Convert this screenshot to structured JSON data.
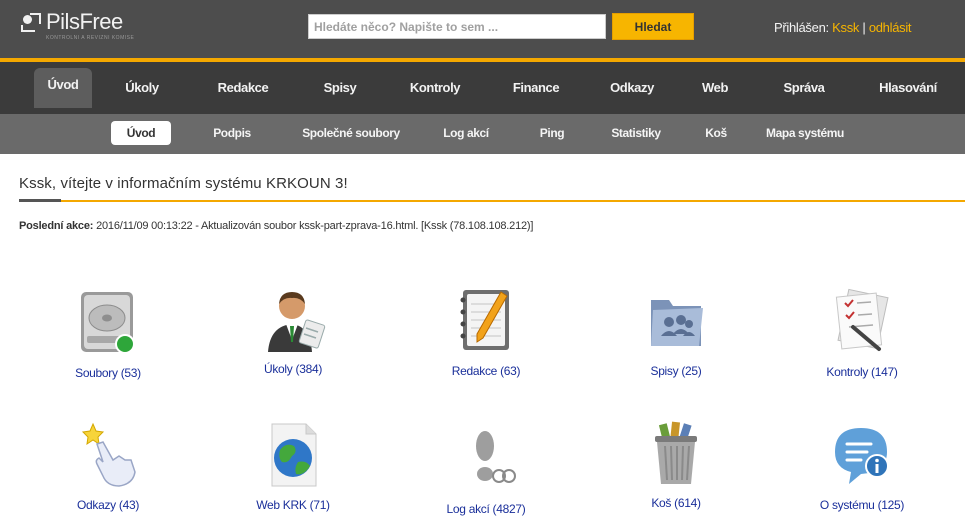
{
  "header": {
    "logo_text": "PilsFree",
    "logo_subtitle": "KONTROLNI A REVIZNI KOMISE",
    "search_placeholder": "Hledáte něco? Napište to sem ...",
    "search_button": "Hledat",
    "login_prefix": "Přihlášen: ",
    "login_user": "Kssk",
    "login_separator": " | ",
    "logout_label": "odhlásit"
  },
  "main_nav": {
    "items": [
      {
        "label": "Úvod",
        "active": true
      },
      {
        "label": "Úkoly"
      },
      {
        "label": "Redakce"
      },
      {
        "label": "Spisy"
      },
      {
        "label": "Kontroly"
      },
      {
        "label": "Finance"
      },
      {
        "label": "Odkazy"
      },
      {
        "label": "Web"
      },
      {
        "label": "Správa"
      },
      {
        "label": "Hlasování"
      }
    ]
  },
  "sub_nav": {
    "items": [
      {
        "label": "Úvod",
        "active": true
      },
      {
        "label": "Podpis"
      },
      {
        "label": "Společné soubory"
      },
      {
        "label": "Log akcí"
      },
      {
        "label": "Ping"
      },
      {
        "label": "Statistiky"
      },
      {
        "label": "Koš"
      },
      {
        "label": "Mapa systému"
      }
    ]
  },
  "content": {
    "welcome": "Kssk, vítejte v informačním systému KRKOUN 3!",
    "last_action_label": "Poslední akce:",
    "last_action_text": " 2016/11/09 00:13:22 - Aktualizován soubor kssk-part-zprava-16.html. [Kssk (78.108.108.212)]"
  },
  "tiles": [
    {
      "label": "Soubory (53)",
      "icon": "hard-drive-icon"
    },
    {
      "label": "Úkoly (384)",
      "icon": "businessman-icon"
    },
    {
      "label": "Redakce (63)",
      "icon": "notepad-pencil-icon"
    },
    {
      "label": "Spisy (25)",
      "icon": "folder-users-icon"
    },
    {
      "label": "Kontroly (147)",
      "icon": "checklist-icon"
    },
    {
      "label": "Odkazy (43)",
      "icon": "pointing-hand-icon"
    },
    {
      "label": "Web KRK (71)",
      "icon": "globe-page-icon"
    },
    {
      "label": "Log akcí (4827)",
      "icon": "footprint-icon"
    },
    {
      "label": "Koš (614)",
      "icon": "trash-bin-icon"
    },
    {
      "label": "O systému (125)",
      "icon": "info-bubble-icon"
    }
  ],
  "colors": {
    "accent": "#f4a800",
    "header_bg": "#4d4d4d",
    "nav_bg": "#3b3b3b",
    "subnav_bg": "#6a6a6a",
    "link": "#1a2f9a"
  }
}
